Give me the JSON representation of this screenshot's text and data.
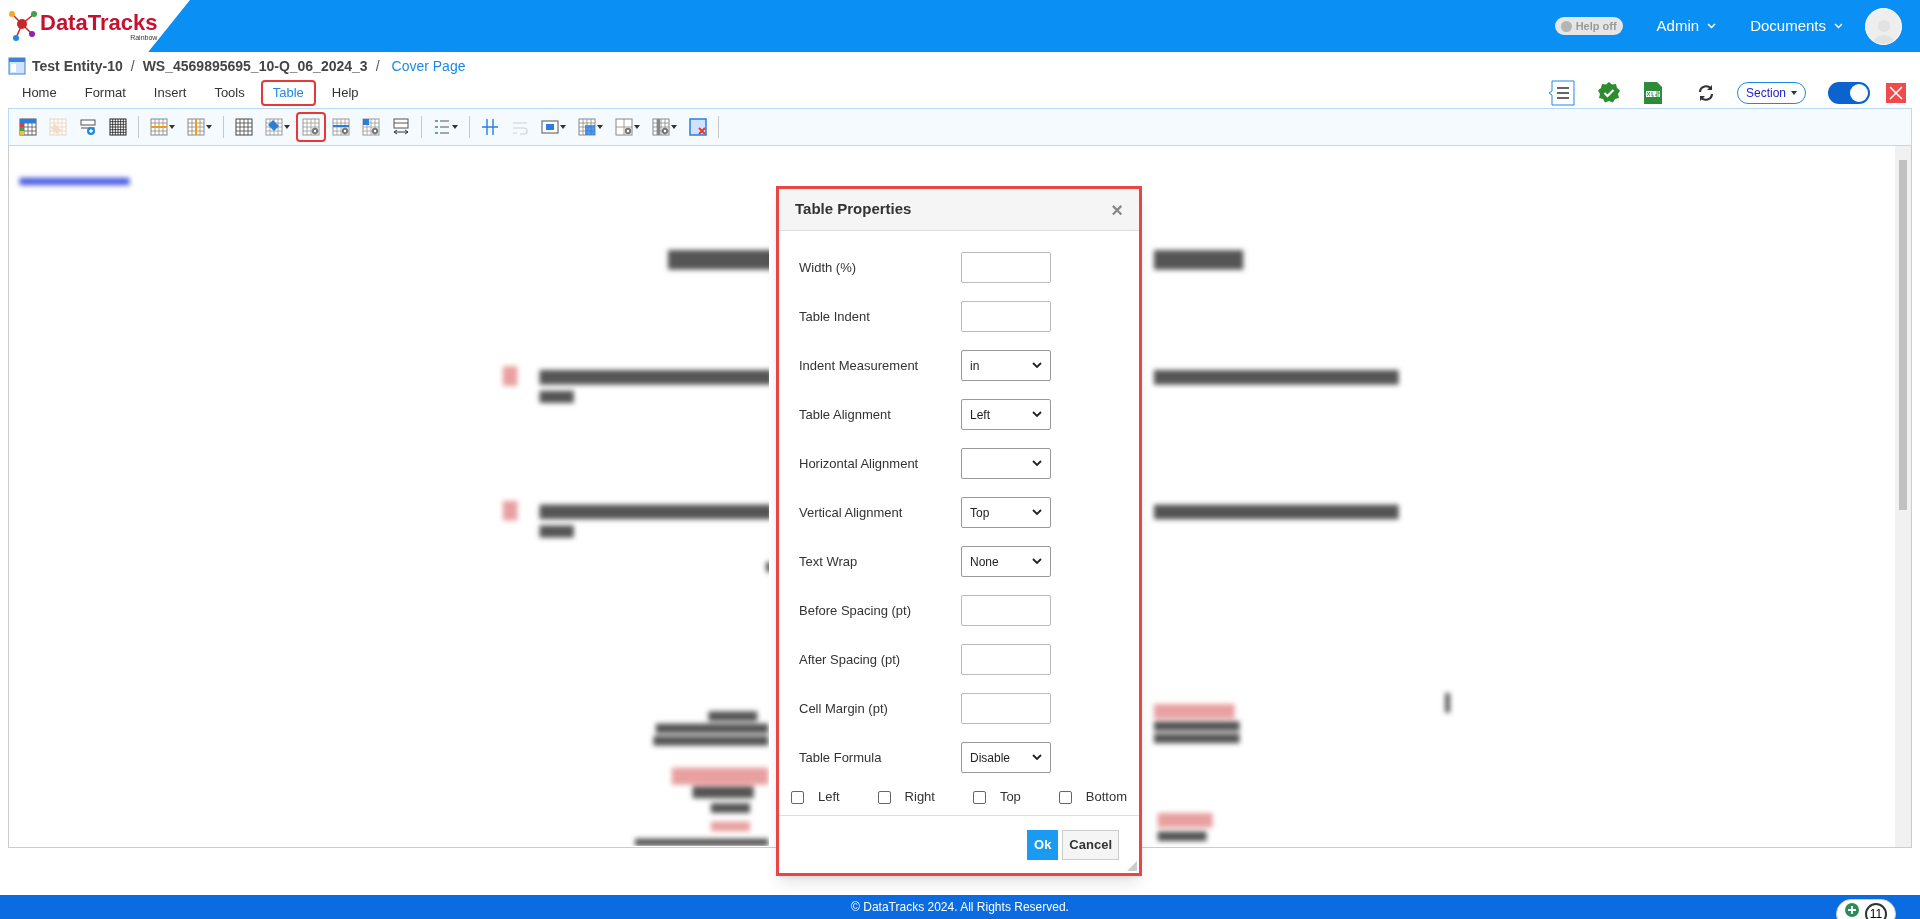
{
  "header": {
    "logo": {
      "name": "DataTracks",
      "sub": "Rainbow"
    },
    "help_toggle": {
      "label": "Help off",
      "on": false
    },
    "menus": [
      "Admin",
      "Documents"
    ]
  },
  "breadcrumb": [
    {
      "kind": "strong",
      "text": "Test Entity-10"
    },
    {
      "kind": "sep",
      "text": "/"
    },
    {
      "kind": "strong",
      "text": "WS_4569895695_10-Q_06_2024_3"
    },
    {
      "kind": "sep",
      "text": "/"
    },
    {
      "kind": "link",
      "text": "Cover Page"
    }
  ],
  "tabs": [
    {
      "label": "Home",
      "selected": false,
      "highlighted": false
    },
    {
      "label": "Format",
      "selected": false,
      "highlighted": false
    },
    {
      "label": "Insert",
      "selected": false,
      "highlighted": false
    },
    {
      "label": "Tools",
      "selected": false,
      "highlighted": false
    },
    {
      "label": "Table",
      "selected": true,
      "highlighted": true
    },
    {
      "label": "Help",
      "selected": false,
      "highlighted": false
    }
  ],
  "right_tools": {
    "section": {
      "label": "Section"
    },
    "edit_toggle": {
      "on": true
    }
  },
  "toolbar": [
    {
      "kind": "color-table",
      "dropdown": false,
      "disabled": false,
      "highlighted": false
    },
    {
      "kind": "paint",
      "dropdown": false,
      "disabled": true,
      "highlighted": false
    },
    {
      "kind": "insert-row",
      "dropdown": false,
      "disabled": false,
      "highlighted": false
    },
    {
      "kind": "dotted-grid",
      "dropdown": false,
      "disabled": false,
      "highlighted": false
    },
    {
      "kind": "sep"
    },
    {
      "kind": "row-lines",
      "dropdown": true,
      "disabled": false,
      "highlighted": false
    },
    {
      "kind": "column-lines",
      "dropdown": true,
      "disabled": false,
      "highlighted": false
    },
    {
      "kind": "sep"
    },
    {
      "kind": "grid",
      "dropdown": false,
      "disabled": false,
      "highlighted": false
    },
    {
      "kind": "fill",
      "dropdown": true,
      "disabled": false,
      "highlighted": false
    },
    {
      "kind": "table-gear",
      "dropdown": false,
      "disabled": false,
      "highlighted": true
    },
    {
      "kind": "row-gear",
      "dropdown": false,
      "disabled": false,
      "highlighted": false
    },
    {
      "kind": "cell-gear",
      "dropdown": false,
      "disabled": false,
      "highlighted": false
    },
    {
      "kind": "width",
      "dropdown": false,
      "disabled": false,
      "highlighted": false
    },
    {
      "kind": "sep"
    },
    {
      "kind": "list",
      "dropdown": true,
      "disabled": false,
      "highlighted": false
    },
    {
      "kind": "sep"
    },
    {
      "kind": "divider-lines",
      "dropdown": false,
      "disabled": false,
      "highlighted": false
    },
    {
      "kind": "wrap",
      "dropdown": false,
      "disabled": true,
      "highlighted": false
    },
    {
      "kind": "cell",
      "dropdown": true,
      "disabled": false,
      "highlighted": false
    },
    {
      "kind": "merge",
      "dropdown": true,
      "disabled": false,
      "highlighted": false
    },
    {
      "kind": "formula",
      "dropdown": true,
      "disabled": false,
      "highlighted": false
    },
    {
      "kind": "column-gear",
      "dropdown": true,
      "disabled": false,
      "highlighted": false
    },
    {
      "kind": "delete-table",
      "dropdown": false,
      "disabled": false,
      "highlighted": false
    },
    {
      "kind": "sep"
    }
  ],
  "dialog": {
    "title": "Table Properties",
    "close": "×",
    "highlighted": true,
    "fields": [
      {
        "kind": "input",
        "label": "Width (%)"
      },
      {
        "kind": "input",
        "label": "Table Indent"
      },
      {
        "kind": "select",
        "label": "Indent Measurement",
        "value": "in"
      },
      {
        "kind": "select",
        "label": "Table Alignment",
        "value": "Left"
      },
      {
        "kind": "select",
        "label": "Horizontal Alignment"
      },
      {
        "kind": "select",
        "label": "Vertical Alignment",
        "value": "Top"
      },
      {
        "kind": "select",
        "label": "Text Wrap",
        "value": "None"
      },
      {
        "kind": "input",
        "label": "Before Spacing (pt)"
      },
      {
        "kind": "input",
        "label": "After Spacing (pt)"
      },
      {
        "kind": "input",
        "label": "Cell Margin (pt)"
      },
      {
        "kind": "select",
        "label": "Table Formula",
        "value": "Disable"
      }
    ],
    "borders": [
      {
        "label": "Left",
        "checked": false
      },
      {
        "label": "Right",
        "checked": false
      },
      {
        "label": "Top",
        "checked": false
      },
      {
        "label": "Bottom",
        "checked": false
      }
    ],
    "buttons": [
      {
        "kind": "primary",
        "label": "Ok"
      },
      {
        "kind": "secondary",
        "label": "Cancel"
      }
    ]
  },
  "footer": {
    "text": "© DataTracks 2024. All Rights Reserved.",
    "badge": "11"
  }
}
